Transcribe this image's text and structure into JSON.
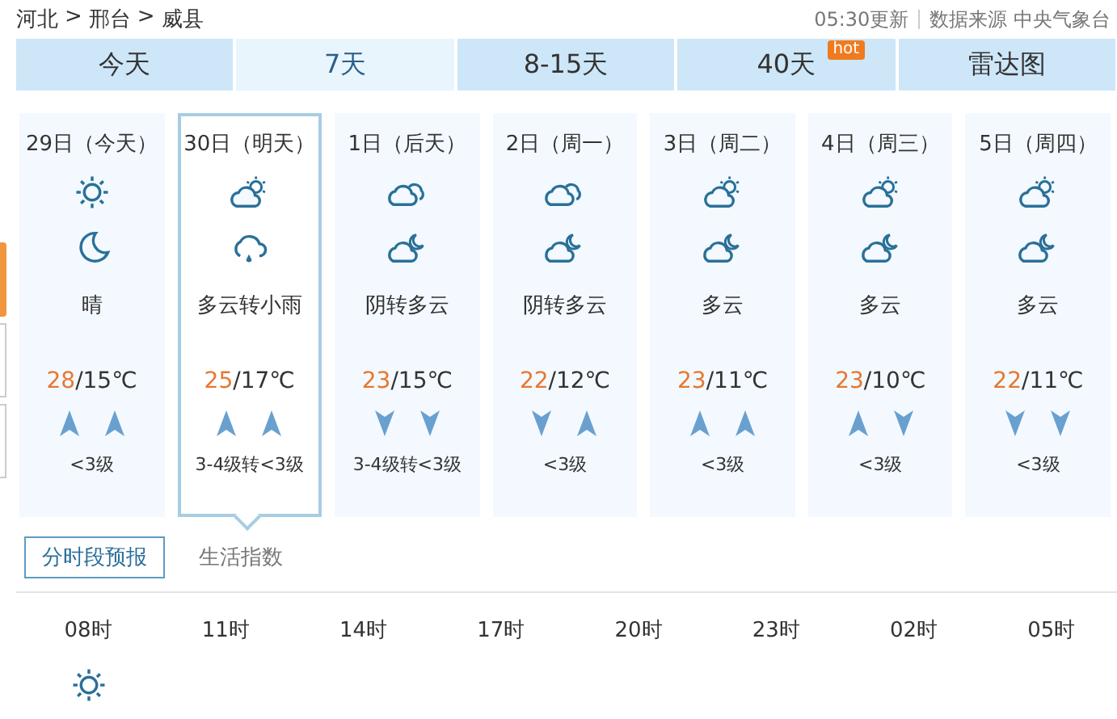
{
  "breadcrumb": [
    "河北",
    ">",
    "邢台",
    ">",
    "威县"
  ],
  "update": {
    "time": "05:30更新",
    "source": "数据来源 中央气象台"
  },
  "tabs": [
    {
      "label": "今天",
      "selected": false
    },
    {
      "label": "7天",
      "selected": true
    },
    {
      "label": "8-15天",
      "selected": false
    },
    {
      "label": "40天",
      "selected": false,
      "badge": "hot"
    },
    {
      "label": "雷达图",
      "selected": false
    }
  ],
  "side_tabs": [
    {
      "selected": true
    },
    {
      "selected": false
    },
    {
      "selected": false
    }
  ],
  "days": [
    {
      "date": "29日（今天）",
      "selected": false,
      "icons": [
        {
          "kind": "sun"
        },
        {
          "kind": "moon"
        }
      ],
      "weather": "晴",
      "high": "28",
      "low": "/15℃",
      "wind": [
        {
          "kind": "up"
        },
        {
          "kind": "up"
        }
      ],
      "wind_level": "<3级"
    },
    {
      "date": "30日（明天）",
      "selected": true,
      "icons": [
        {
          "kind": "cloud-sun"
        },
        {
          "kind": "rain"
        }
      ],
      "weather": "多云转小雨",
      "high": "25",
      "low": "/17℃",
      "wind": [
        {
          "kind": "up"
        },
        {
          "kind": "up"
        }
      ],
      "wind_level": "3-4级转<3级"
    },
    {
      "date": "1日（后天）",
      "selected": false,
      "icons": [
        {
          "kind": "overcast"
        },
        {
          "kind": "cloud-moon"
        }
      ],
      "weather": "阴转多云",
      "high": "23",
      "low": "/15℃",
      "wind": [
        {
          "kind": "down"
        },
        {
          "kind": "down"
        }
      ],
      "wind_level": "3-4级转<3级"
    },
    {
      "date": "2日（周一）",
      "selected": false,
      "icons": [
        {
          "kind": "overcast"
        },
        {
          "kind": "cloud-moon"
        }
      ],
      "weather": "阴转多云",
      "high": "22",
      "low": "/12℃",
      "wind": [
        {
          "kind": "down"
        },
        {
          "kind": "up"
        }
      ],
      "wind_level": "<3级"
    },
    {
      "date": "3日（周二）",
      "selected": false,
      "icons": [
        {
          "kind": "cloud-sun"
        },
        {
          "kind": "cloud-moon"
        }
      ],
      "weather": "多云",
      "high": "23",
      "low": "/11℃",
      "wind": [
        {
          "kind": "up"
        },
        {
          "kind": "up"
        }
      ],
      "wind_level": "<3级"
    },
    {
      "date": "4日（周三）",
      "selected": false,
      "icons": [
        {
          "kind": "cloud-sun"
        },
        {
          "kind": "cloud-moon"
        }
      ],
      "weather": "多云",
      "high": "23",
      "low": "/10℃",
      "wind": [
        {
          "kind": "up"
        },
        {
          "kind": "down"
        }
      ],
      "wind_level": "<3级"
    },
    {
      "date": "5日（周四）",
      "selected": false,
      "icons": [
        {
          "kind": "cloud-sun"
        },
        {
          "kind": "cloud-moon"
        }
      ],
      "weather": "多云",
      "high": "22",
      "low": "/11℃",
      "wind": [
        {
          "kind": "down"
        },
        {
          "kind": "down"
        }
      ],
      "wind_level": "<3级"
    }
  ],
  "subtabs": [
    {
      "label": "分时段预报",
      "selected": true
    },
    {
      "label": "生活指数",
      "selected": false
    }
  ],
  "hours": [
    {
      "time": "08时",
      "icons": [
        {
          "kind": "sun"
        }
      ]
    },
    {
      "time": "11时"
    },
    {
      "time": "14时"
    },
    {
      "time": "17时"
    },
    {
      "time": "20时"
    },
    {
      "time": "23时"
    },
    {
      "time": "02时"
    },
    {
      "time": "05时"
    }
  ]
}
